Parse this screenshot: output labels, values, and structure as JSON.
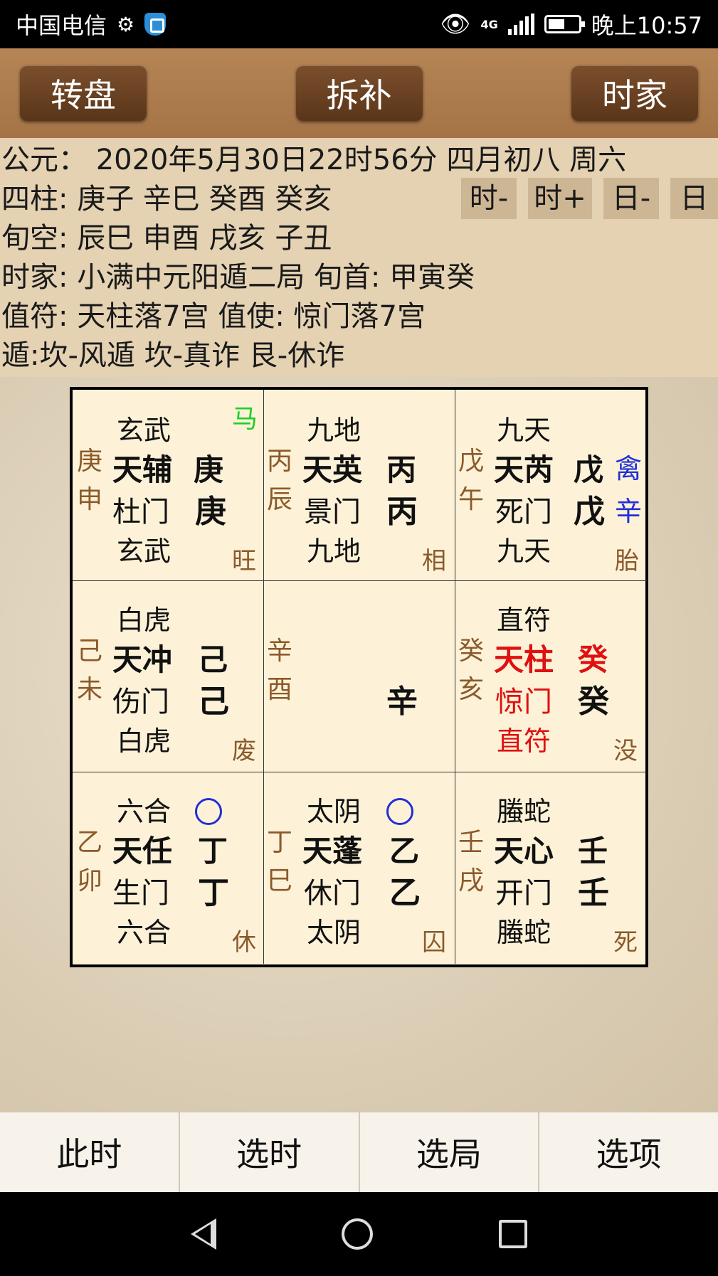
{
  "status": {
    "carrier": "中国电信",
    "network": "4G",
    "time": "晚上10:57"
  },
  "toolbar": {
    "left": "转盘",
    "center": "拆补",
    "right": "时家"
  },
  "info": {
    "line1": "公元：  2020年5月30日22时56分  四月初八  周六",
    "line2": "四柱: 庚子    辛巳    癸酉    癸亥",
    "line3": "旬空: 辰巳    申酉    戌亥    子丑",
    "line4": "时家: 小满中元阳遁二局    旬首: 甲寅癸",
    "line5": "值符: 天柱落7宫    值使: 惊门落7宫",
    "line6": "遁:坎-风遁  坎-真诈  艮-休诈",
    "chips": [
      "时-",
      "时+",
      "日-",
      "日"
    ]
  },
  "palaces": [
    {
      "god": "玄武",
      "star": "天辅",
      "star_stem": "庚",
      "door": "杜门",
      "door_stem": "庚",
      "god2": "玄武",
      "side1": "庚",
      "side2": "申",
      "state": "旺",
      "mark": "马"
    },
    {
      "god": "九地",
      "star": "天英",
      "star_stem": "丙",
      "door": "景门",
      "door_stem": "丙",
      "god2": "九地",
      "side1": "丙",
      "side2": "辰",
      "state": "相"
    },
    {
      "god": "九天",
      "star": "天芮",
      "star_stem": "戊",
      "door": "死门",
      "door_stem": "戊",
      "god2": "九天",
      "side1": "戊",
      "side2": "午",
      "state": "胎",
      "extra1": "禽",
      "extra2": "辛"
    },
    {
      "god": "白虎",
      "star": "天冲",
      "star_stem": "己",
      "door": "伤门",
      "door_stem": "己",
      "god2": "白虎",
      "side1": "己",
      "side2": "未",
      "state": "废"
    },
    {
      "side1": "辛",
      "side2": "酉",
      "center_stem": "辛"
    },
    {
      "god": "直符",
      "star": "天柱",
      "star_stem": "癸",
      "door": "惊门",
      "door_stem": "癸",
      "god2": "直符",
      "side1": "癸",
      "side2": "亥",
      "state": "没"
    },
    {
      "god": "六合",
      "star": "天任",
      "star_stem": "丁",
      "door": "生门",
      "door_stem": "丁",
      "god2": "六合",
      "side1": "乙",
      "side2": "卯",
      "state": "休"
    },
    {
      "god": "太阴",
      "star": "天蓬",
      "star_stem": "乙",
      "door": "休门",
      "door_stem": "乙",
      "god2": "太阴",
      "side1": "丁",
      "side2": "巳",
      "state": "囚"
    },
    {
      "god": "螣蛇",
      "star": "天心",
      "star_stem": "壬",
      "door": "开门",
      "door_stem": "壬",
      "god2": "螣蛇",
      "side1": "壬",
      "side2": "戌",
      "state": "死"
    }
  ],
  "bottom": {
    "b1": "此时",
    "b2": "选时",
    "b3": "选局",
    "b4": "选项"
  }
}
